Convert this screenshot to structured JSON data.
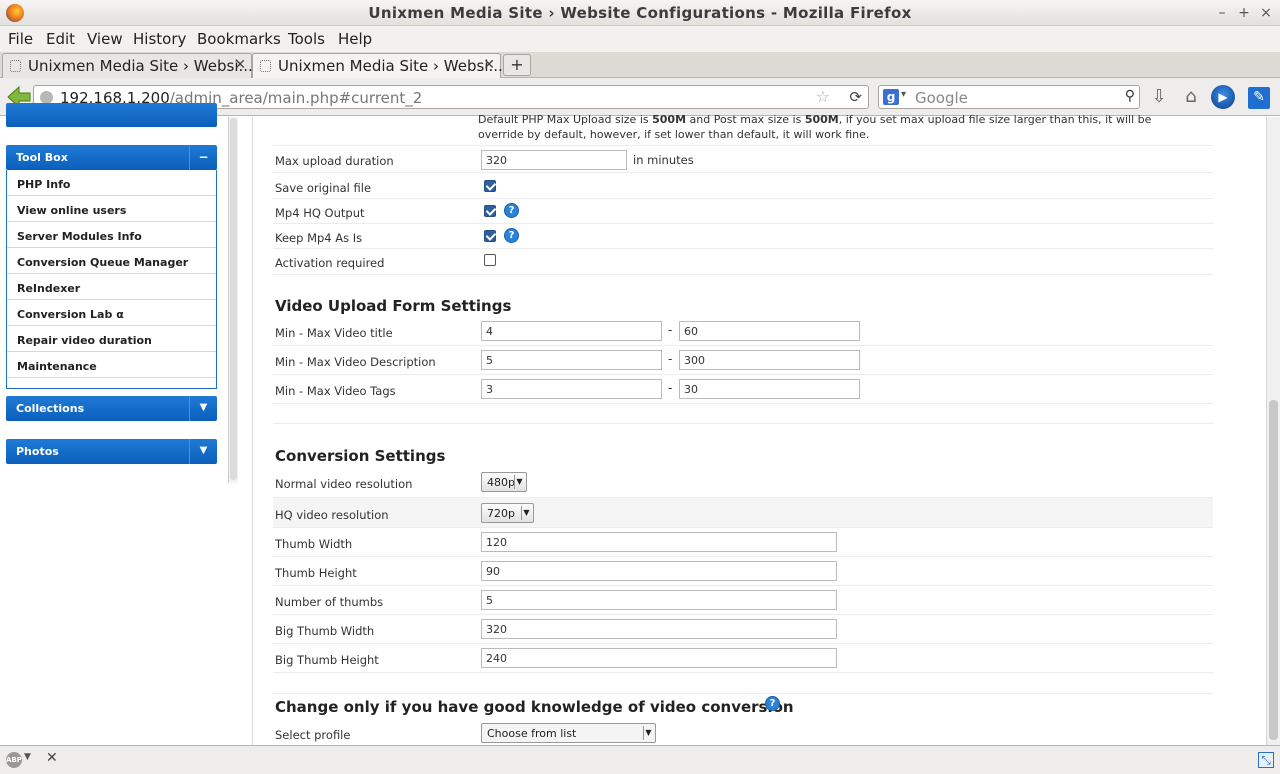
{
  "window": {
    "title": "Unixmen Media Site › Website Configurations - Mozilla Firefox",
    "minimize": "–",
    "maximize": "+",
    "close": "×"
  },
  "menu": [
    "File",
    "Edit",
    "View",
    "History",
    "Bookmarks",
    "Tools",
    "Help"
  ],
  "tabs": [
    {
      "label": "Unixmen Media Site › Websi...",
      "close": "✕"
    },
    {
      "label": "Unixmen Media Site › Websi...",
      "close": "✕"
    }
  ],
  "new_tab": "+",
  "nav": {
    "url_host": "192.168.1.200",
    "url_path": "/admin_area/main.php#current_2",
    "search_engine": "g",
    "search_placeholder": "Google"
  },
  "sidebar": {
    "toolbox_title": "Tool Box",
    "toolbox_toggle": "−",
    "toolbox_items": [
      "PHP Info",
      "View online users",
      "Server Modules Info",
      "Conversion Queue Manager",
      "ReIndexer",
      "Conversion Lab α",
      "Repair video duration",
      "Maintenance"
    ],
    "collections_title": "Collections",
    "photos_title": "Photos",
    "collapsed_toggle": "▼"
  },
  "main": {
    "notice_line1_a": "Default PHP Max Upload size is ",
    "notice_line1_b": "500M",
    "notice_line1_c": " and Post max size is ",
    "notice_line1_d": "500M",
    "notice_line1_e": ", if you set max upload file size larger than this, it will be",
    "notice_line2": "override by default, however, if set lower than default, it will work fine.",
    "max_upload_label": "Max upload duration",
    "max_upload_value": "320",
    "max_upload_unit": "in minutes",
    "save_original_label": "Save original file",
    "save_original_checked": true,
    "mp4_hq_label": "Mp4 HQ Output",
    "mp4_hq_checked": true,
    "keep_mp4_label": "Keep Mp4 As Is",
    "keep_mp4_checked": true,
    "activation_label": "Activation required",
    "activation_checked": false,
    "help_glyph": "?",
    "video_upload_heading": "Video Upload Form Settings",
    "range_dash": "-",
    "title_label": "Min - Max Video title",
    "title_min": "4",
    "title_max": "60",
    "desc_label": "Min - Max Video Description",
    "desc_min": "5",
    "desc_max": "300",
    "tags_label": "Min - Max Video Tags",
    "tags_min": "3",
    "tags_max": "30",
    "conversion_heading": "Conversion Settings",
    "normal_res_label": "Normal video resolution",
    "normal_res_value": "480p",
    "hq_res_label": "HQ video resolution",
    "hq_res_value": "720p",
    "thumb_width_label": "Thumb Width",
    "thumb_width_value": "120",
    "thumb_height_label": "Thumb Height",
    "thumb_height_value": "90",
    "num_thumbs_label": "Number of thumbs",
    "num_thumbs_value": "5",
    "big_thumb_width_label": "Big Thumb Width",
    "big_thumb_width_value": "320",
    "big_thumb_height_label": "Big Thumb Height",
    "big_thumb_height_value": "240",
    "advanced_heading": "Change only if you have good knowledge of video conversion",
    "profile_label": "Select profile",
    "profile_value": "Choose from list"
  },
  "status": {
    "abp": "ABP",
    "close": "✕"
  }
}
